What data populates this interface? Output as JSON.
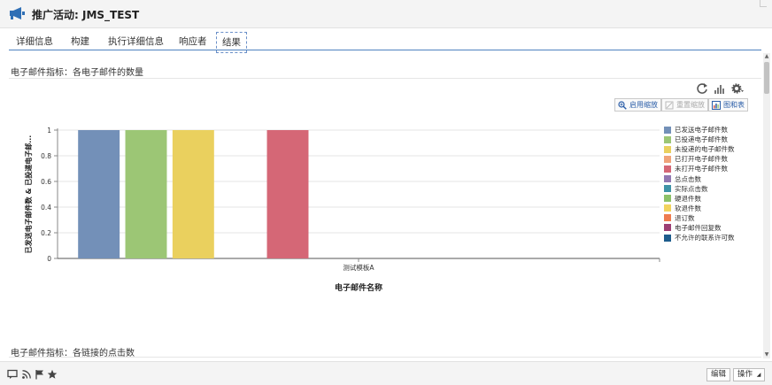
{
  "window": {
    "title": "推广活动: JMS_TEST"
  },
  "tabs": [
    {
      "label": "详细信息"
    },
    {
      "label": "构建"
    },
    {
      "label": "执行详细信息"
    },
    {
      "label": "响应者"
    },
    {
      "label": "结果",
      "active": true
    }
  ],
  "section1": {
    "label": "电子邮件指标：各电子邮件的数量"
  },
  "section2": {
    "label": "电子邮件指标：各链接的点击数"
  },
  "toolbar_icons": [
    "refresh-icon",
    "bar-chart-icon",
    "settings-gear-icon"
  ],
  "chart_buttons": [
    {
      "label": "启用缩放",
      "icon": "zoom-in-icon",
      "enabled": true
    },
    {
      "label": "重置缩放",
      "icon": "reset-zoom-icon",
      "enabled": false
    },
    {
      "label": "图和表",
      "icon": "chart-table-icon",
      "enabled": true
    }
  ],
  "chart_data": {
    "type": "bar",
    "categories": [
      "测试模板A"
    ],
    "xlabel": "电子邮件名称",
    "ylabel": "已发送电子邮件数 & 已投递电子邮...",
    "ylim": [
      0,
      1
    ],
    "yticks": [
      "0",
      "0.2",
      "0.4",
      "0.6",
      "0.8",
      "1"
    ],
    "grid": true,
    "legend_position": "right",
    "series": [
      {
        "name": "已发送电子邮件数",
        "color": "#7390b8",
        "values": [
          1
        ]
      },
      {
        "name": "已投递电子邮件数",
        "color": "#9cc675",
        "values": [
          1
        ]
      },
      {
        "name": "未投递的电子邮件数",
        "color": "#ead05e",
        "values": [
          1
        ]
      },
      {
        "name": "已打开电子邮件数",
        "color": "#f0a37a",
        "values": [
          0
        ]
      },
      {
        "name": "未打开电子邮件数",
        "color": "#d56776",
        "values": [
          1
        ]
      },
      {
        "name": "总点击数",
        "color": "#9178b2",
        "values": [
          0
        ]
      },
      {
        "name": "实际点击数",
        "color": "#3f93a7",
        "values": [
          0
        ]
      },
      {
        "name": "硬退件数",
        "color": "#8dc168",
        "values": [
          0
        ]
      },
      {
        "name": "软退件数",
        "color": "#f2d35e",
        "values": [
          0
        ]
      },
      {
        "name": "退订数",
        "color": "#ee7b4f",
        "values": [
          0
        ]
      },
      {
        "name": "电子邮件回复数",
        "color": "#9c3e74",
        "values": [
          0
        ]
      },
      {
        "name": "不允许的联系许可数",
        "color": "#1d5c8c",
        "values": [
          0
        ]
      }
    ]
  },
  "footer": {
    "icons": [
      "comment-icon",
      "rss-icon",
      "flag-icon",
      "star-icon"
    ],
    "edit_label": "编辑",
    "actions_label": "操作"
  }
}
